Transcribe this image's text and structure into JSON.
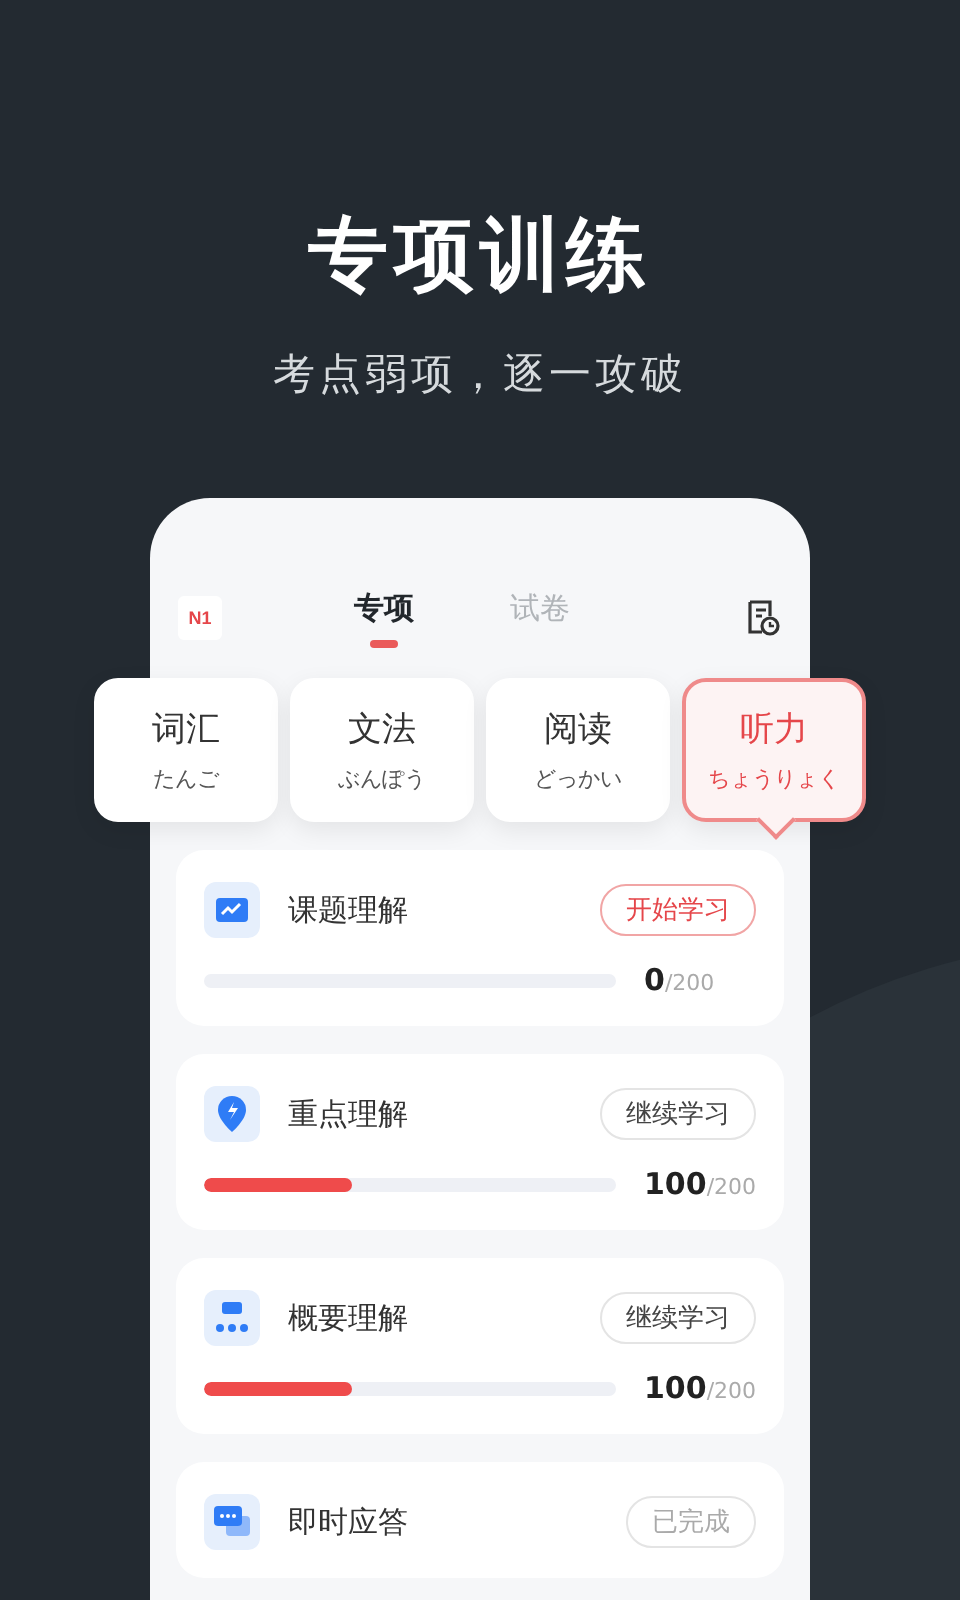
{
  "headline": "专项训练",
  "subtitle": "考点弱项，逐一攻破",
  "header": {
    "level_badge": "N1",
    "tabs": [
      {
        "label": "专项",
        "selected": true
      },
      {
        "label": "试卷",
        "selected": false
      }
    ]
  },
  "categories": [
    {
      "label": "词汇",
      "reading": "たんご",
      "selected": false
    },
    {
      "label": "文法",
      "reading": "ぶんぽう",
      "selected": false
    },
    {
      "label": "阅读",
      "reading": "どっかい",
      "selected": false
    },
    {
      "label": "听力",
      "reading": "ちょうりょく",
      "selected": true
    }
  ],
  "sections": [
    {
      "title": "课题理解",
      "action": {
        "label": "开始学习",
        "kind": "start"
      },
      "level": 0,
      "done": "0",
      "total": "/200"
    },
    {
      "title": "重点理解",
      "action": {
        "label": "继续学习",
        "kind": "continue"
      },
      "level": 0.36,
      "done": "100",
      "total": "/200"
    },
    {
      "title": "概要理解",
      "action": {
        "label": "继续学习",
        "kind": "continue"
      },
      "level": 0.36,
      "done": "100",
      "total": "/200"
    },
    {
      "title": "即时应答",
      "action": {
        "label": "已完成",
        "kind": "done"
      }
    }
  ]
}
